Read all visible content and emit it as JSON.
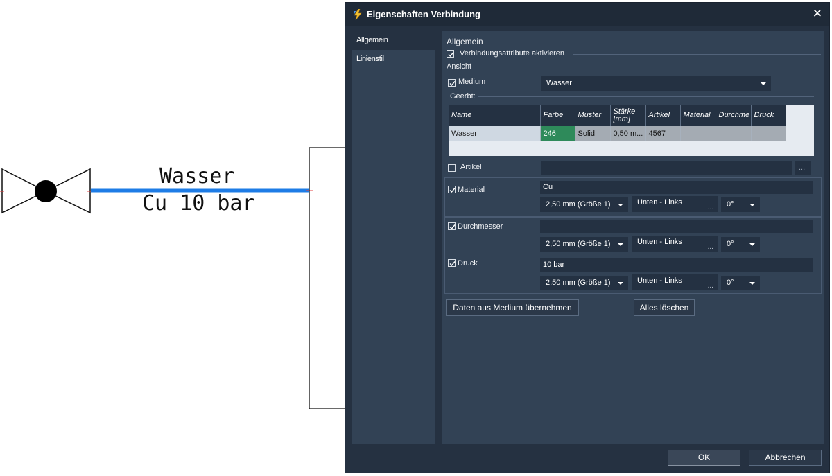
{
  "drawing": {
    "label_medium": "Wasser",
    "label_props": "Cu 10 bar",
    "line_color": "#1e7ce6"
  },
  "dialog": {
    "title": "Eigenschaften Verbindung",
    "close_glyph": "✕",
    "nav": {
      "items": [
        {
          "label": "Allgemein",
          "active": true
        },
        {
          "label": "Linienstil",
          "active": false
        }
      ]
    },
    "general": {
      "section_title": "Allgemein",
      "enable_attributes": {
        "label": "Verbindungsattribute aktivieren",
        "checked": true
      },
      "view_group": "Ansicht",
      "medium": {
        "label": "Medium",
        "checked": true,
        "value": "Wasser"
      },
      "inherited_label": "Geerbt:",
      "inherited_table": {
        "columns": [
          "Name",
          "Farbe",
          "Muster",
          "Stärke [mm]",
          "Artikel",
          "Material",
          "Durchmesser",
          "Druck"
        ],
        "columns_shown": [
          "Name",
          "Farbe",
          "Muster",
          "Stärke\n[mm]",
          "Artikel",
          "Material",
          "Durchme",
          "Druck"
        ],
        "rows": [
          {
            "name": "Wasser",
            "farbe": "246",
            "farbe_color": "#2e8a5a",
            "muster": "Solid",
            "staerke": "0,50 m...",
            "artikel": "4567",
            "material": "",
            "durchmesser": "",
            "druck": ""
          }
        ]
      },
      "artikel": {
        "label": "Artikel",
        "checked": false,
        "value": "",
        "browse": "..."
      },
      "material": {
        "label": "Material",
        "checked": true,
        "value": "Cu",
        "size": "2,50 mm (Größe 1)",
        "position": "Unten - Links",
        "position_more": "...",
        "angle": "0°"
      },
      "durchmesser": {
        "label": "Durchmesser",
        "checked": true,
        "value": "",
        "size": "2,50 mm (Größe 1)",
        "position": "Unten - Links",
        "position_more": "...",
        "angle": "0°"
      },
      "druck": {
        "label": "Druck",
        "checked": true,
        "value": "10 bar",
        "size": "2,50 mm (Größe 1)",
        "position": "Unten - Links",
        "position_more": "...",
        "angle": "0°"
      },
      "btn_take_over": "Daten aus Medium übernehmen",
      "btn_clear_all": "Alles löschen"
    },
    "footer": {
      "ok": "OK",
      "cancel": "Abbrechen"
    }
  }
}
